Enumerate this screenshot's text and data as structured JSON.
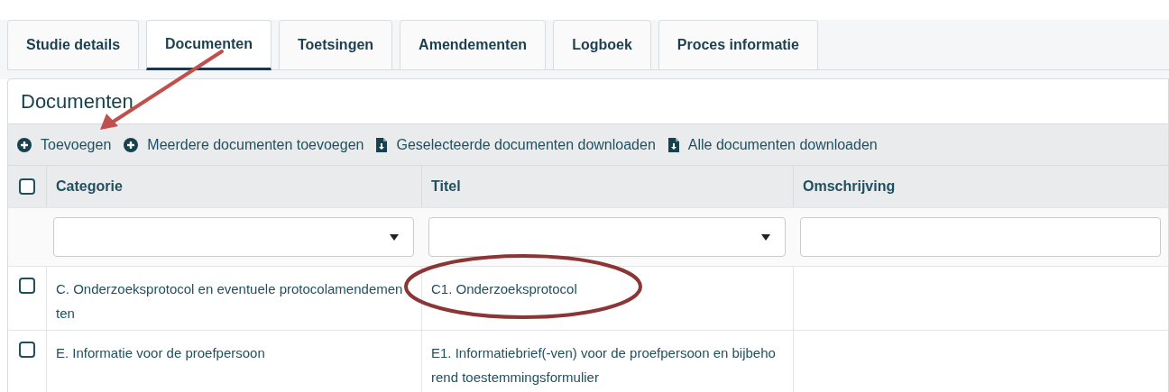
{
  "tabs": [
    {
      "label": "Studie details",
      "selected": false
    },
    {
      "label": "Documenten",
      "selected": true
    },
    {
      "label": "Toetsingen",
      "selected": false
    },
    {
      "label": "Amendementen",
      "selected": false
    },
    {
      "label": "Logboek",
      "selected": false
    },
    {
      "label": "Proces informatie",
      "selected": false
    }
  ],
  "panel": {
    "title": "Documenten"
  },
  "toolbar": [
    {
      "label": "Toevoegen",
      "kind": "add"
    },
    {
      "label": "Meerdere documenten toevoegen",
      "kind": "add"
    },
    {
      "label": "Geselecteerde documenten downloaden",
      "kind": "download"
    },
    {
      "label": "Alle documenten downloaden",
      "kind": "download"
    }
  ],
  "table": {
    "select_all": {
      "checked": false
    },
    "columns": [
      "Categorie",
      "Titel",
      "Omschrijving"
    ],
    "filters": [
      {
        "kind": "select"
      },
      {
        "kind": "select"
      },
      {
        "kind": "text"
      }
    ],
    "rows": [
      {
        "checked": false,
        "cells": [
          "C. Onderzoeksprotocol en eventuele protocolamendementen",
          "C1. Onderzoeksprotocol"
        ]
      },
      {
        "checked": false,
        "cells": [
          "E. Informatie voor de proefpersoon",
          "E1. Informatiebrief(-ven) voor de proefpersoon en bijbehorend toestemmingsformulier"
        ]
      }
    ]
  }
}
